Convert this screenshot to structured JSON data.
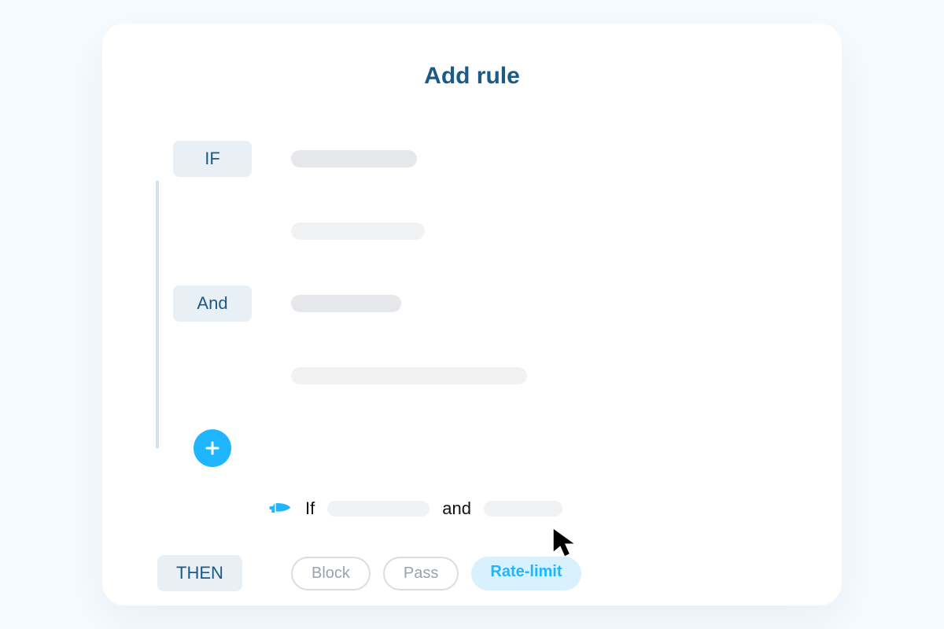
{
  "title": "Add rule",
  "conditions": {
    "if_label": "IF",
    "and_label": "And"
  },
  "add_icon": "plus",
  "summary": {
    "icon": "pointing-hand",
    "if_text": "If",
    "and_text": "and"
  },
  "then": {
    "label": "THEN",
    "actions": [
      {
        "label": "Block",
        "selected": false
      },
      {
        "label": "Pass",
        "selected": false
      },
      {
        "label": "Rate-limit",
        "selected": true
      }
    ]
  }
}
